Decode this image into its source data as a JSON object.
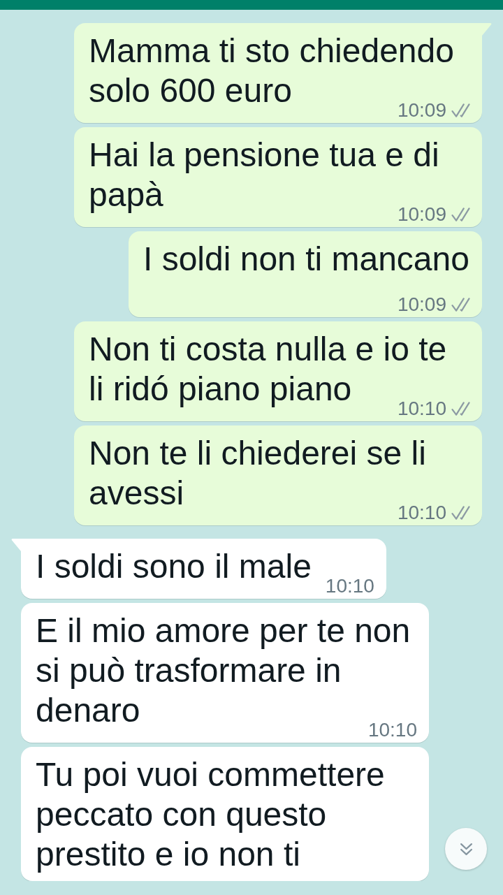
{
  "messages": [
    {
      "kind": "outgoing",
      "text": "Mamma ti sto chiedendo solo 600 euro",
      "time": "10:09",
      "read": false
    },
    {
      "kind": "outgoing",
      "text": "Hai la pensione tua e di papà",
      "time": "10:09",
      "read": false
    },
    {
      "kind": "outgoing",
      "text": "I soldi non ti mancano",
      "time": "10:09",
      "read": false
    },
    {
      "kind": "outgoing",
      "text": "Non ti costa nulla e io te li ridó piano piano",
      "time": "10:10",
      "read": false
    },
    {
      "kind": "outgoing",
      "text": "Non te li chiederei se li avessi",
      "time": "10:10",
      "read": false
    },
    {
      "kind": "incoming",
      "text": "I soldi sono il male",
      "time": "10:10"
    },
    {
      "kind": "incoming",
      "text": "E il mio amore per te non si può trasformare in denaro",
      "time": "10:10"
    },
    {
      "kind": "incoming",
      "text": "Tu poi vuoi commettere peccato con questo prestito e io non ti"
    }
  ]
}
